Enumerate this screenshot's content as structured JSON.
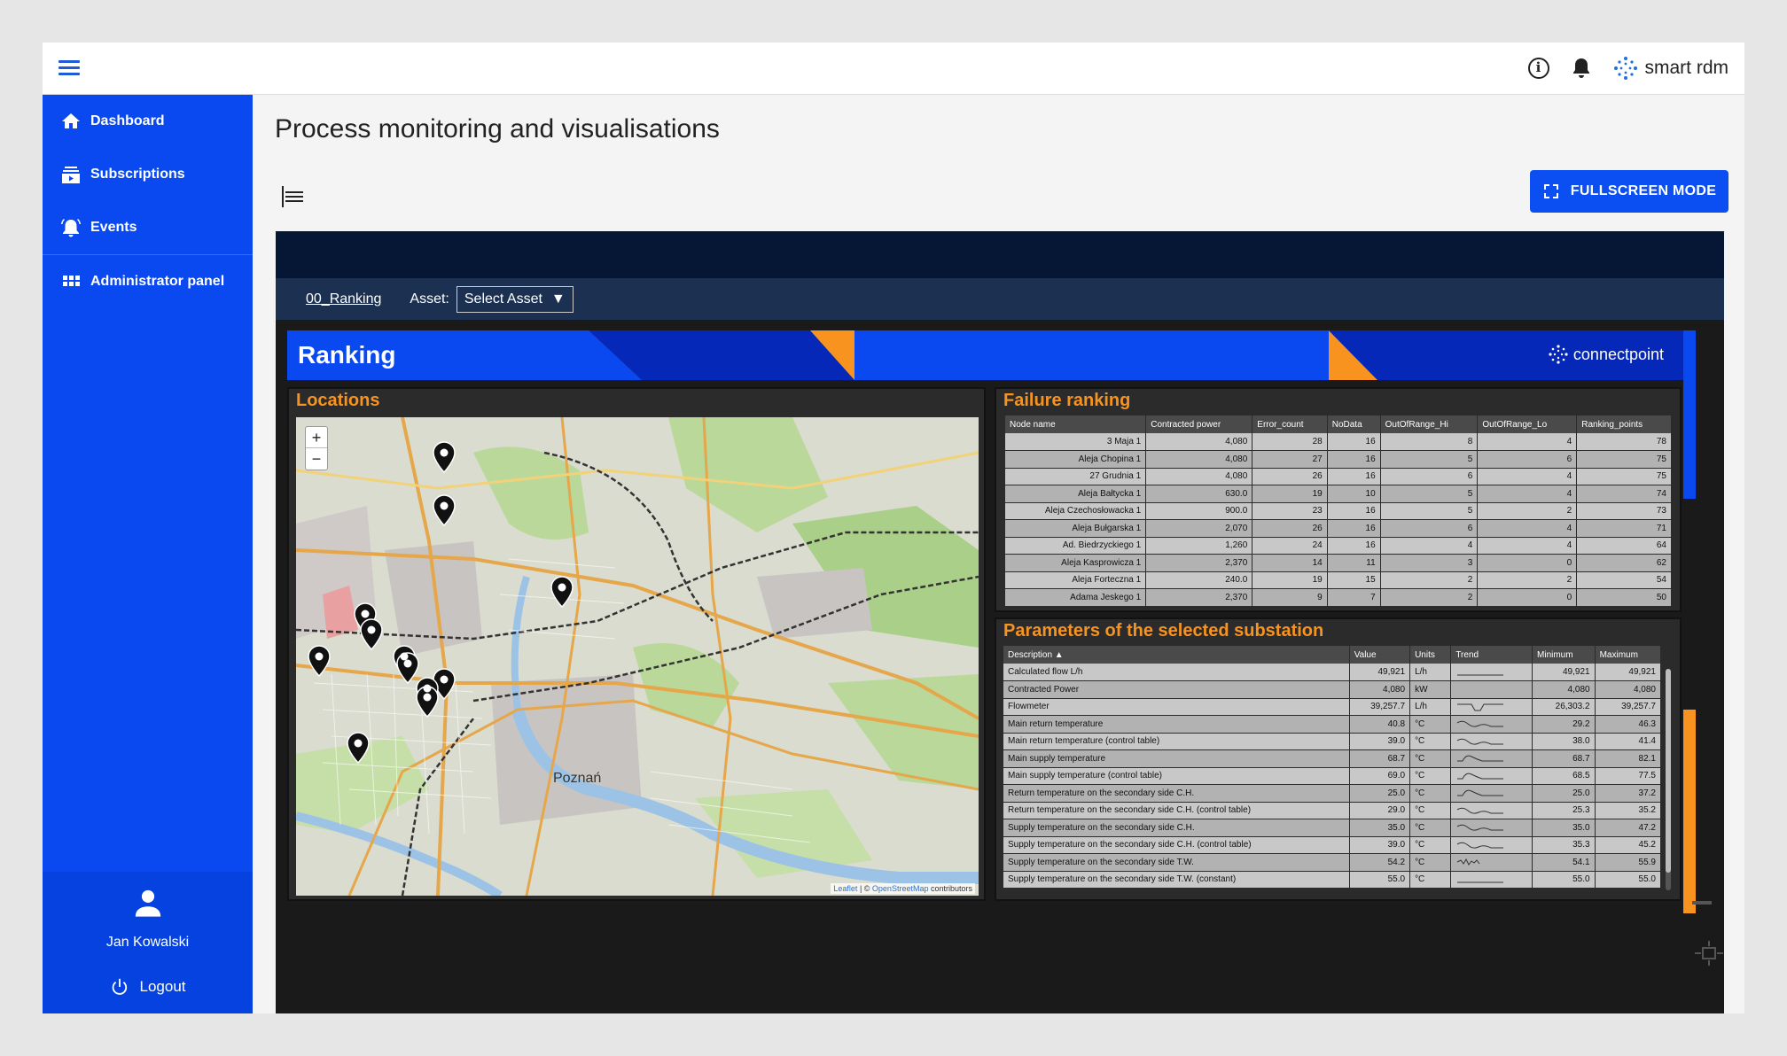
{
  "topbar": {
    "brand": "smart rdm",
    "info_icon": "info-icon",
    "bell_icon": "bell-icon"
  },
  "sidebar": {
    "items": [
      {
        "label": "Dashboard",
        "icon": "home-icon"
      },
      {
        "label": "Subscriptions",
        "icon": "subscriptions-icon"
      },
      {
        "label": "Events",
        "icon": "alarm-icon"
      },
      {
        "label": "Administrator panel",
        "icon": "grid-icon"
      }
    ],
    "user_name": "Jan Kowalski",
    "logout_label": "Logout"
  },
  "main": {
    "title": "Process monitoring and visualisations",
    "fullscreen_label": "FULLSCREEN MODE"
  },
  "dashboard": {
    "link": "00_Ranking",
    "asset_label": "Asset:",
    "asset_value": "Select Asset",
    "banner_title": "Ranking",
    "banner_logo": "connectpoint",
    "locations_title": "Locations",
    "map_label": "Poznań",
    "map_attribution": {
      "leaflet": "Leaflet",
      "sep": " | © ",
      "osm": "OpenStreetMap",
      "suffix": " contributors"
    },
    "failure_title": "Failure ranking",
    "failure_headers": [
      "Node name",
      "Contracted power",
      "Error_count",
      "NoData",
      "OutOfRange_Hi",
      "OutOfRange_Lo",
      "Ranking_points"
    ],
    "failure_rows": [
      [
        "3 Maja 1",
        "4,080",
        "28",
        "16",
        "8",
        "4",
        "78"
      ],
      [
        "Aleja Chopina 1",
        "4,080",
        "27",
        "16",
        "5",
        "6",
        "75"
      ],
      [
        "27 Grudnia 1",
        "4,080",
        "26",
        "16",
        "6",
        "4",
        "75"
      ],
      [
        "Aleja Bałtycka 1",
        "630.0",
        "19",
        "10",
        "5",
        "4",
        "74"
      ],
      [
        "Aleja Czechosłowacka 1",
        "900.0",
        "23",
        "16",
        "5",
        "2",
        "73"
      ],
      [
        "Aleja Bułgarska 1",
        "2,070",
        "26",
        "16",
        "6",
        "4",
        "71"
      ],
      [
        "Ad. Biedrzyckiego 1",
        "1,260",
        "24",
        "16",
        "4",
        "4",
        "64"
      ],
      [
        "Aleja Kasprowicza 1",
        "2,370",
        "14",
        "11",
        "3",
        "0",
        "62"
      ],
      [
        "Aleja Forteczna 1",
        "240.0",
        "19",
        "15",
        "2",
        "2",
        "54"
      ],
      [
        "Adama Jeskego 1",
        "2,370",
        "9",
        "7",
        "2",
        "0",
        "50"
      ]
    ],
    "params_title": "Parameters of the selected substation",
    "params_headers": [
      "Description ▲",
      "Value",
      "Units",
      "Trend",
      "Minimum",
      "Maximum"
    ],
    "params_rows": [
      [
        "Calculated flow L/h",
        "49,921",
        "L/h",
        "flat",
        "49,921",
        "49,921"
      ],
      [
        "Contracted Power",
        "4,080",
        "kW",
        "none",
        "4,080",
        "4,080"
      ],
      [
        "Flowmeter",
        "39,257.7",
        "L/h",
        "dip",
        "26,303.2",
        "39,257.7"
      ],
      [
        "Main return temperature",
        "40.8",
        "°C",
        "wave",
        "29.2",
        "46.3"
      ],
      [
        "Main return temperature (control table)",
        "39.0",
        "°C",
        "wave",
        "38.0",
        "41.4"
      ],
      [
        "Main supply temperature",
        "68.7",
        "°C",
        "bump",
        "68.7",
        "82.1"
      ],
      [
        "Main supply temperature (control table)",
        "69.0",
        "°C",
        "bump",
        "68.5",
        "77.5"
      ],
      [
        "Return temperature on the secondary side C.H.",
        "25.0",
        "°C",
        "bump",
        "25.0",
        "37.2"
      ],
      [
        "Return temperature on the secondary side C.H. (control table)",
        "29.0",
        "°C",
        "wave",
        "25.3",
        "35.2"
      ],
      [
        "Supply temperature on the secondary side C.H.",
        "35.0",
        "°C",
        "wave",
        "35.0",
        "47.2"
      ],
      [
        "Supply temperature on the secondary side C.H. (control table)",
        "39.0",
        "°C",
        "wave",
        "35.3",
        "45.2"
      ],
      [
        "Supply temperature on the secondary side T.W.",
        "54.2",
        "°C",
        "noise",
        "54.1",
        "55.9"
      ],
      [
        "Supply temperature on the secondary side T.W. (constant)",
        "55.0",
        "°C",
        "flat",
        "55.0",
        "55.0"
      ]
    ]
  }
}
